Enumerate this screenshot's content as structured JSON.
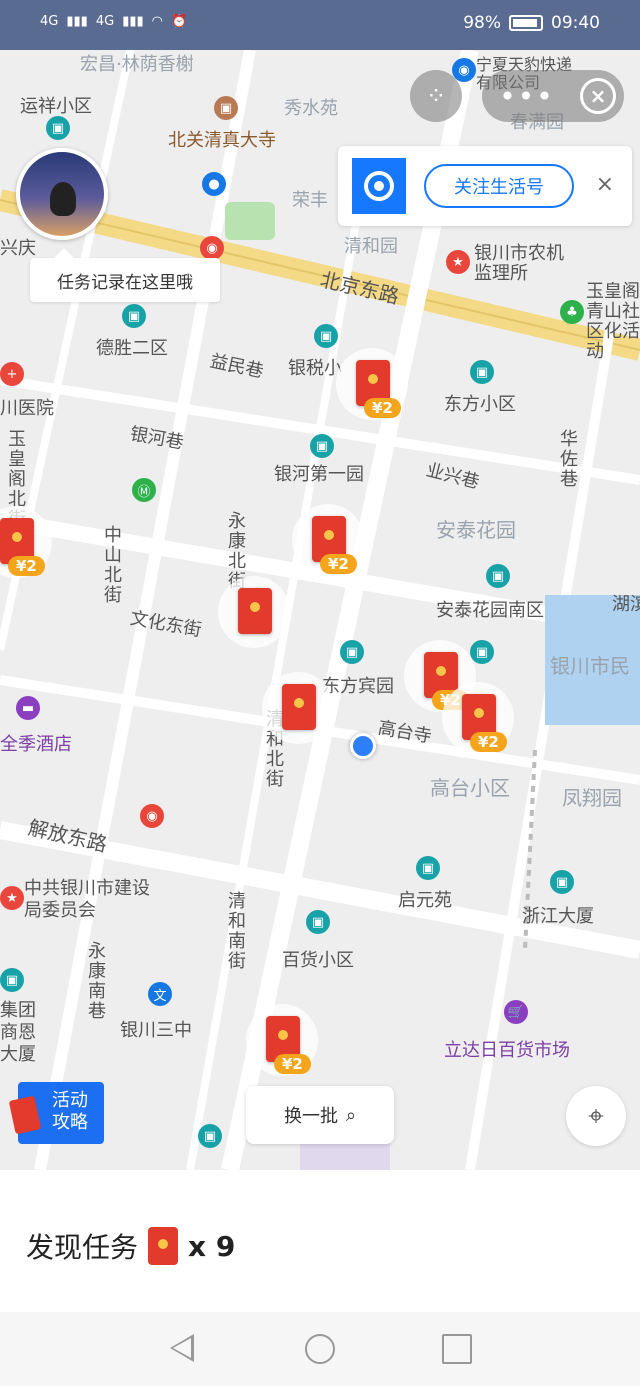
{
  "status_bar": {
    "signal_1": "4G",
    "signal_2": "4G",
    "battery": "98%",
    "time": "09:40"
  },
  "map": {
    "places": [
      "宏昌·林荫香榭",
      "运祥小区",
      "北关清真大寺",
      "秀水苑",
      "宁夏天豹快递有限公司",
      "春满园",
      "荣丰",
      "清和园",
      "银川市农机监理所",
      "北京东路",
      "玉皇阁青山社区化活动",
      "德胜二区",
      "益民巷",
      "银税小",
      "东方小区",
      "川医院",
      "银河巷",
      "银河第一园",
      "业兴巷",
      "华佐巷",
      "安泰花园",
      "永康北街",
      "中山北街",
      "文化东街",
      "安泰花园南区",
      "湖滨",
      "银川市民",
      "东方宾园",
      "高台寺",
      "高台小区",
      "凤翔园",
      "全季酒店",
      "玉皇阁北街",
      "兴庆",
      "解放东路",
      "中共银川市建设局委员会",
      "启元苑",
      "浙江大厦",
      "清和南街",
      "百货小区",
      "永康南巷",
      "银川三中",
      "集团商恩大厦",
      "立达日百货市场",
      "清和北街"
    ],
    "packets": [
      {
        "amount": "¥2"
      },
      {
        "amount": "¥2"
      },
      {
        "amount": "¥2"
      },
      {
        "amount": ""
      },
      {
        "amount": "¥2"
      },
      {
        "amount": ""
      },
      {
        "amount": "¥2"
      },
      {
        "amount": "¥2"
      },
      {
        "amount": "¥2"
      }
    ]
  },
  "top_controls": {
    "scan_icon": "scan-icon",
    "more_label": "•••",
    "close_icon": "close-circle-icon"
  },
  "follow_card": {
    "button_label": "关注生活号",
    "close_label": "×"
  },
  "avatar": {
    "tip": "任务记录在这里哦"
  },
  "controls": {
    "guide_label_1": "活动",
    "guide_label_2": "攻略",
    "refresh_label": "换一批",
    "search_icon": "search-icon",
    "locate_icon": "target-icon"
  },
  "panel": {
    "title": "发现任务",
    "count": "x 9"
  }
}
